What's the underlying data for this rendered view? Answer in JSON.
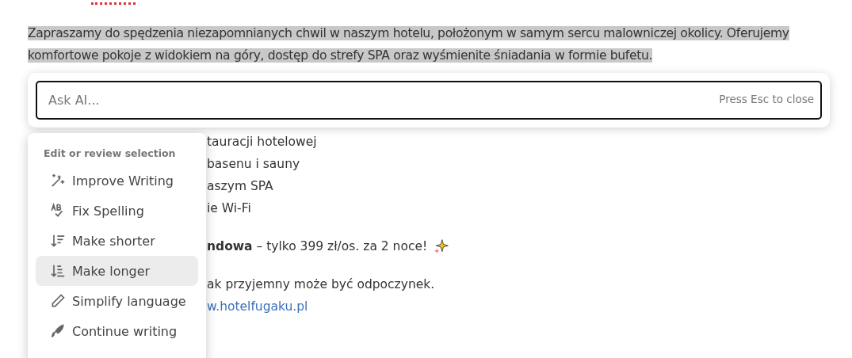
{
  "document": {
    "selected_paragraph": "Zapraszamy do spędzenia niezapomnianych chwil w naszym hotelu, położonym w samym sercu malowniczej okolicy. Oferujemy komfortowe pokoje z widokiem na góry, dostęp do strefy SPA oraz wyśmienite śniadania w formie bufetu.",
    "lines": [
      {
        "kind": "text",
        "text": "tauracji hotelowej"
      },
      {
        "kind": "text",
        "text": "basenu i sauny"
      },
      {
        "kind": "text",
        "text": "aszym SPA"
      },
      {
        "kind": "text",
        "text": "ie Wi-Fi"
      },
      {
        "kind": "offer",
        "text": "**ndowa** – tylko 399 zł/os. za 2 noce!"
      },
      {
        "kind": "text",
        "text": "ak przyjemny może być odpoczynek."
      },
      {
        "kind": "link",
        "text": "w.hotelfugaku.pl"
      }
    ]
  },
  "ask_ai": {
    "placeholder": "Ask AI...",
    "hint": "Press Esc to close"
  },
  "menu": {
    "heading": "Edit or review selection",
    "items": [
      {
        "kind": "wand",
        "label": "Improve Writing",
        "selected": false
      },
      {
        "kind": "spelling",
        "label": "Fix Spelling",
        "selected": false
      },
      {
        "kind": "shorter",
        "label": "Make shorter",
        "selected": false
      },
      {
        "kind": "longer",
        "label": "Make longer",
        "selected": true
      },
      {
        "kind": "pencil",
        "label": "Simplify language",
        "selected": false
      },
      {
        "kind": "pen",
        "label": "Continue writing",
        "selected": false
      }
    ]
  }
}
